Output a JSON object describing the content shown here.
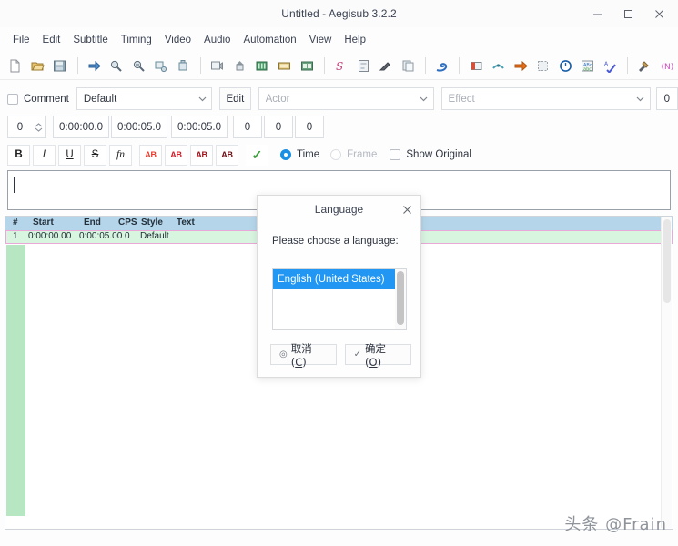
{
  "window": {
    "title": "Untitled - Aegisub 3.2.2",
    "controls": [
      {
        "name": "minimize",
        "glyph": "–"
      },
      {
        "name": "maximize",
        "glyph": "□"
      },
      {
        "name": "close",
        "glyph": "×"
      }
    ]
  },
  "menubar": {
    "items": [
      "File",
      "Edit",
      "Subtitle",
      "Timing",
      "Video",
      "Audio",
      "Automation",
      "View",
      "Help"
    ]
  },
  "toolbar": {
    "groups": [
      [
        "new-subtitles-icon",
        "open-subtitles-icon",
        "save-subtitles-icon"
      ],
      [
        "jump-to-icon",
        "zoom-in-icon",
        "zoom-out-icon",
        "cut-icon",
        "paste-icon"
      ],
      [
        "open-video-icon",
        "close-video-icon",
        "open-audio-icon",
        "open-audio-from-video-icon",
        "spectrum-icon"
      ],
      [
        "styles-manager-icon",
        "attachments-icon",
        "properties-icon",
        "resample-icon"
      ],
      [
        "fonts-collector-icon"
      ],
      [
        "shift-times-icon",
        "timing-post-processor-icon",
        "snap-icon",
        "select-lines-icon",
        "shift-icon",
        "translation-assistant-icon",
        "spell-checker-icon"
      ],
      [
        "automation-icon",
        "kanji-timer-icon"
      ]
    ]
  },
  "edit_bar": {
    "comment_label": "Comment",
    "comment_checked": false,
    "style_value": "Default",
    "edit_button": "Edit",
    "actor_placeholder": "Actor",
    "actor_value": "",
    "effect_placeholder": "Effect",
    "effect_value": "",
    "margin_right_value": "0",
    "layer_value": "0",
    "start_time": "0:00:00.0",
    "end_time": "0:00:05.0",
    "duration": "0:00:05.0",
    "margin_l": "0",
    "margin_r": "0",
    "margin_v": "0",
    "format_buttons": [
      {
        "name": "bold-button",
        "label": "B"
      },
      {
        "name": "italic-button",
        "label": "I"
      },
      {
        "name": "underline-button",
        "label": "U"
      },
      {
        "name": "strikeout-button",
        "label": "S"
      },
      {
        "name": "font-button",
        "label": "fn"
      }
    ],
    "color_buttons": [
      {
        "name": "primary-color-button",
        "label": "AB",
        "color": "#e8392b"
      },
      {
        "name": "secondary-color-button",
        "label": "AB",
        "color": "#d0202a"
      },
      {
        "name": "outline-color-button",
        "label": "AB",
        "color": "#a01018"
      },
      {
        "name": "shadow-color-button",
        "label": "AB",
        "color": "#6d0d12"
      }
    ],
    "commit_button": {
      "name": "commit-button",
      "glyph": "✓"
    },
    "time_label": "Time",
    "frame_label": "Frame",
    "show_original_label": "Show Original",
    "time_selected": true,
    "frame_selected": false,
    "show_original_checked": false
  },
  "text_edit": {
    "value": ""
  },
  "grid": {
    "columns": [
      "#",
      "Start",
      "End",
      "CPS",
      "Style",
      "Text"
    ],
    "rows": [
      {
        "num": "1",
        "start": "0:00:00.00",
        "end": "0:00:05.00",
        "cps": "0",
        "style": "Default",
        "text": ""
      }
    ]
  },
  "dialog": {
    "title": "Language",
    "close_glyph": "×",
    "prompt": "Please choose a language:",
    "options": [
      "English (United States)"
    ],
    "selected": "English (United States)",
    "cancel_button": {
      "label_prefix": "取消(",
      "accel": "C",
      "label_suffix": ")",
      "icon": "◎"
    },
    "ok_button": {
      "label_prefix": "确定(",
      "accel": "O",
      "label_suffix": ")",
      "icon": "✓"
    }
  },
  "watermark": {
    "text": "头条 @Frain"
  }
}
